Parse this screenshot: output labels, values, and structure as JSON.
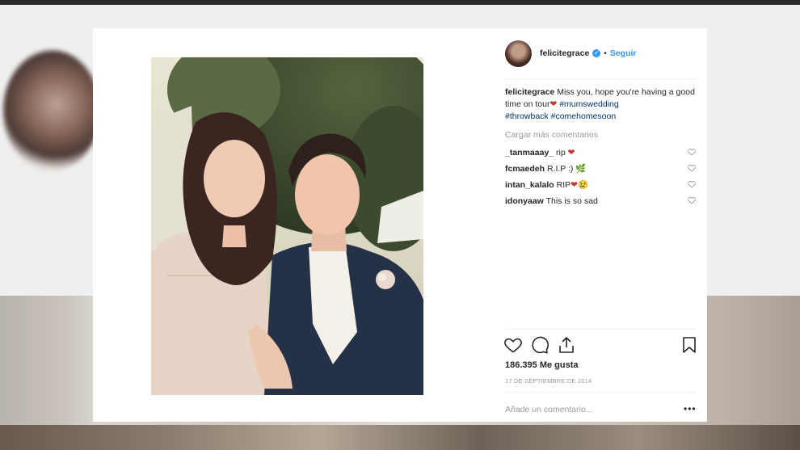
{
  "post": {
    "username": "felicitegrace",
    "follow_label": "Seguir",
    "separator": "•",
    "caption": {
      "username": "felicitegrace",
      "text": "Miss you, hope you're having a good time on tour",
      "emoji": "❤",
      "hashtags": [
        "#mumswedding",
        "#throwback",
        "#comehomesoon"
      ]
    },
    "load_more_label": "Cargar más comentarios",
    "comments": [
      {
        "username": "_tanmaaay_",
        "text": "rip",
        "emoji": "❤"
      },
      {
        "username": "fcmaedeh",
        "text": "R.I.P :)",
        "emoji": "🌿"
      },
      {
        "username": "intan_kalalo",
        "text": "RIP",
        "emoji": "❤😢"
      },
      {
        "username": "idonyaaw",
        "text": "This is so sad",
        "emoji": ""
      }
    ],
    "likes_label": "186.395 Me gusta",
    "date": "17 DE SEPTIEMBRE DE 2014",
    "add_comment_placeholder": "Añade un comentario...",
    "more_label": "•••"
  },
  "icons": {
    "like": "heart-icon",
    "comment": "comment-icon",
    "share": "share-icon",
    "save": "bookmark-icon",
    "verified": "verified-badge-icon"
  },
  "colors": {
    "link": "#3897f0",
    "hashtag": "#003569",
    "text": "#262626",
    "muted": "#999999"
  }
}
